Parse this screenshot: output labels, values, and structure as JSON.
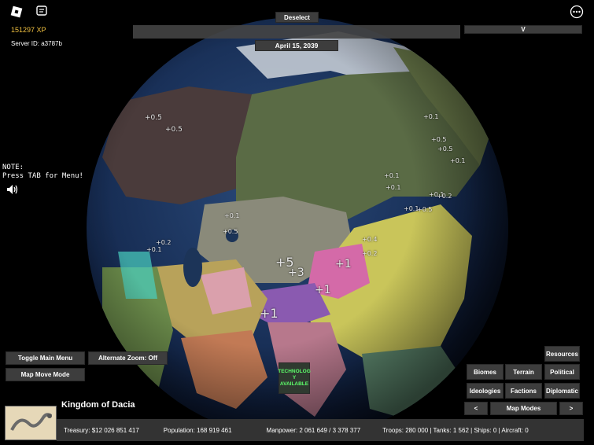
{
  "top": {
    "xp": "151297 XP",
    "server_id": "Server ID: a3787b",
    "deselect": "Deselect",
    "date": "April 15, 2039",
    "v_label": "V",
    "menu_icon": "roblox-logo-icon",
    "chat_icon": "chat-icon",
    "more_icon": "more-options-icon"
  },
  "note": {
    "line1": "NOTE:",
    "line2": "Press TAB for Menu!"
  },
  "controls": {
    "toggle_main_menu": "Toggle Main Menu",
    "alternate_zoom": "Alternate Zoom: Off",
    "map_move_mode": "Map Move Mode"
  },
  "technology": "TECHNOLOG Y AVAILABLE",
  "map_modes": {
    "resources": "Resources",
    "biomes": "Biomes",
    "terrain": "Terrain",
    "political": "Political",
    "ideologies": "Ideologies",
    "factions": "Factions",
    "diplomatic": "Diplomatic",
    "prev": "<",
    "title": "Map Modes",
    "next": ">"
  },
  "country": {
    "name": "Kingdom of Dacia"
  },
  "stats": {
    "treasury": "Treasury:  $12 026 851 417",
    "population": "Population: 168 919 461",
    "manpower": "Manpower:  2 061 649  /  3 378 377",
    "troops": "Troops: 280 000  |  Tanks: 1 562  |  Ships: 0  |  Aircraft: 0"
  },
  "floating": [
    {
      "t": "+0.5"
    },
    {
      "t": "+0.5"
    },
    {
      "t": "+0.1"
    },
    {
      "t": "+0.5"
    },
    {
      "t": "+0.5"
    },
    {
      "t": "+0.1"
    },
    {
      "t": "+0.1"
    },
    {
      "t": "+0.1"
    },
    {
      "t": "+0.1"
    },
    {
      "t": "+0.2"
    },
    {
      "t": "+0.5"
    },
    {
      "t": "+0.1"
    },
    {
      "t": "+0.1"
    },
    {
      "t": "+0.2"
    },
    {
      "t": "+0.1"
    },
    {
      "t": "+5"
    },
    {
      "t": "+3"
    },
    {
      "t": "+1"
    },
    {
      "t": "+1"
    },
    {
      "t": "+1"
    },
    {
      "t": "+0.4"
    },
    {
      "t": "+0.2"
    },
    {
      "t": "+0.5"
    }
  ]
}
